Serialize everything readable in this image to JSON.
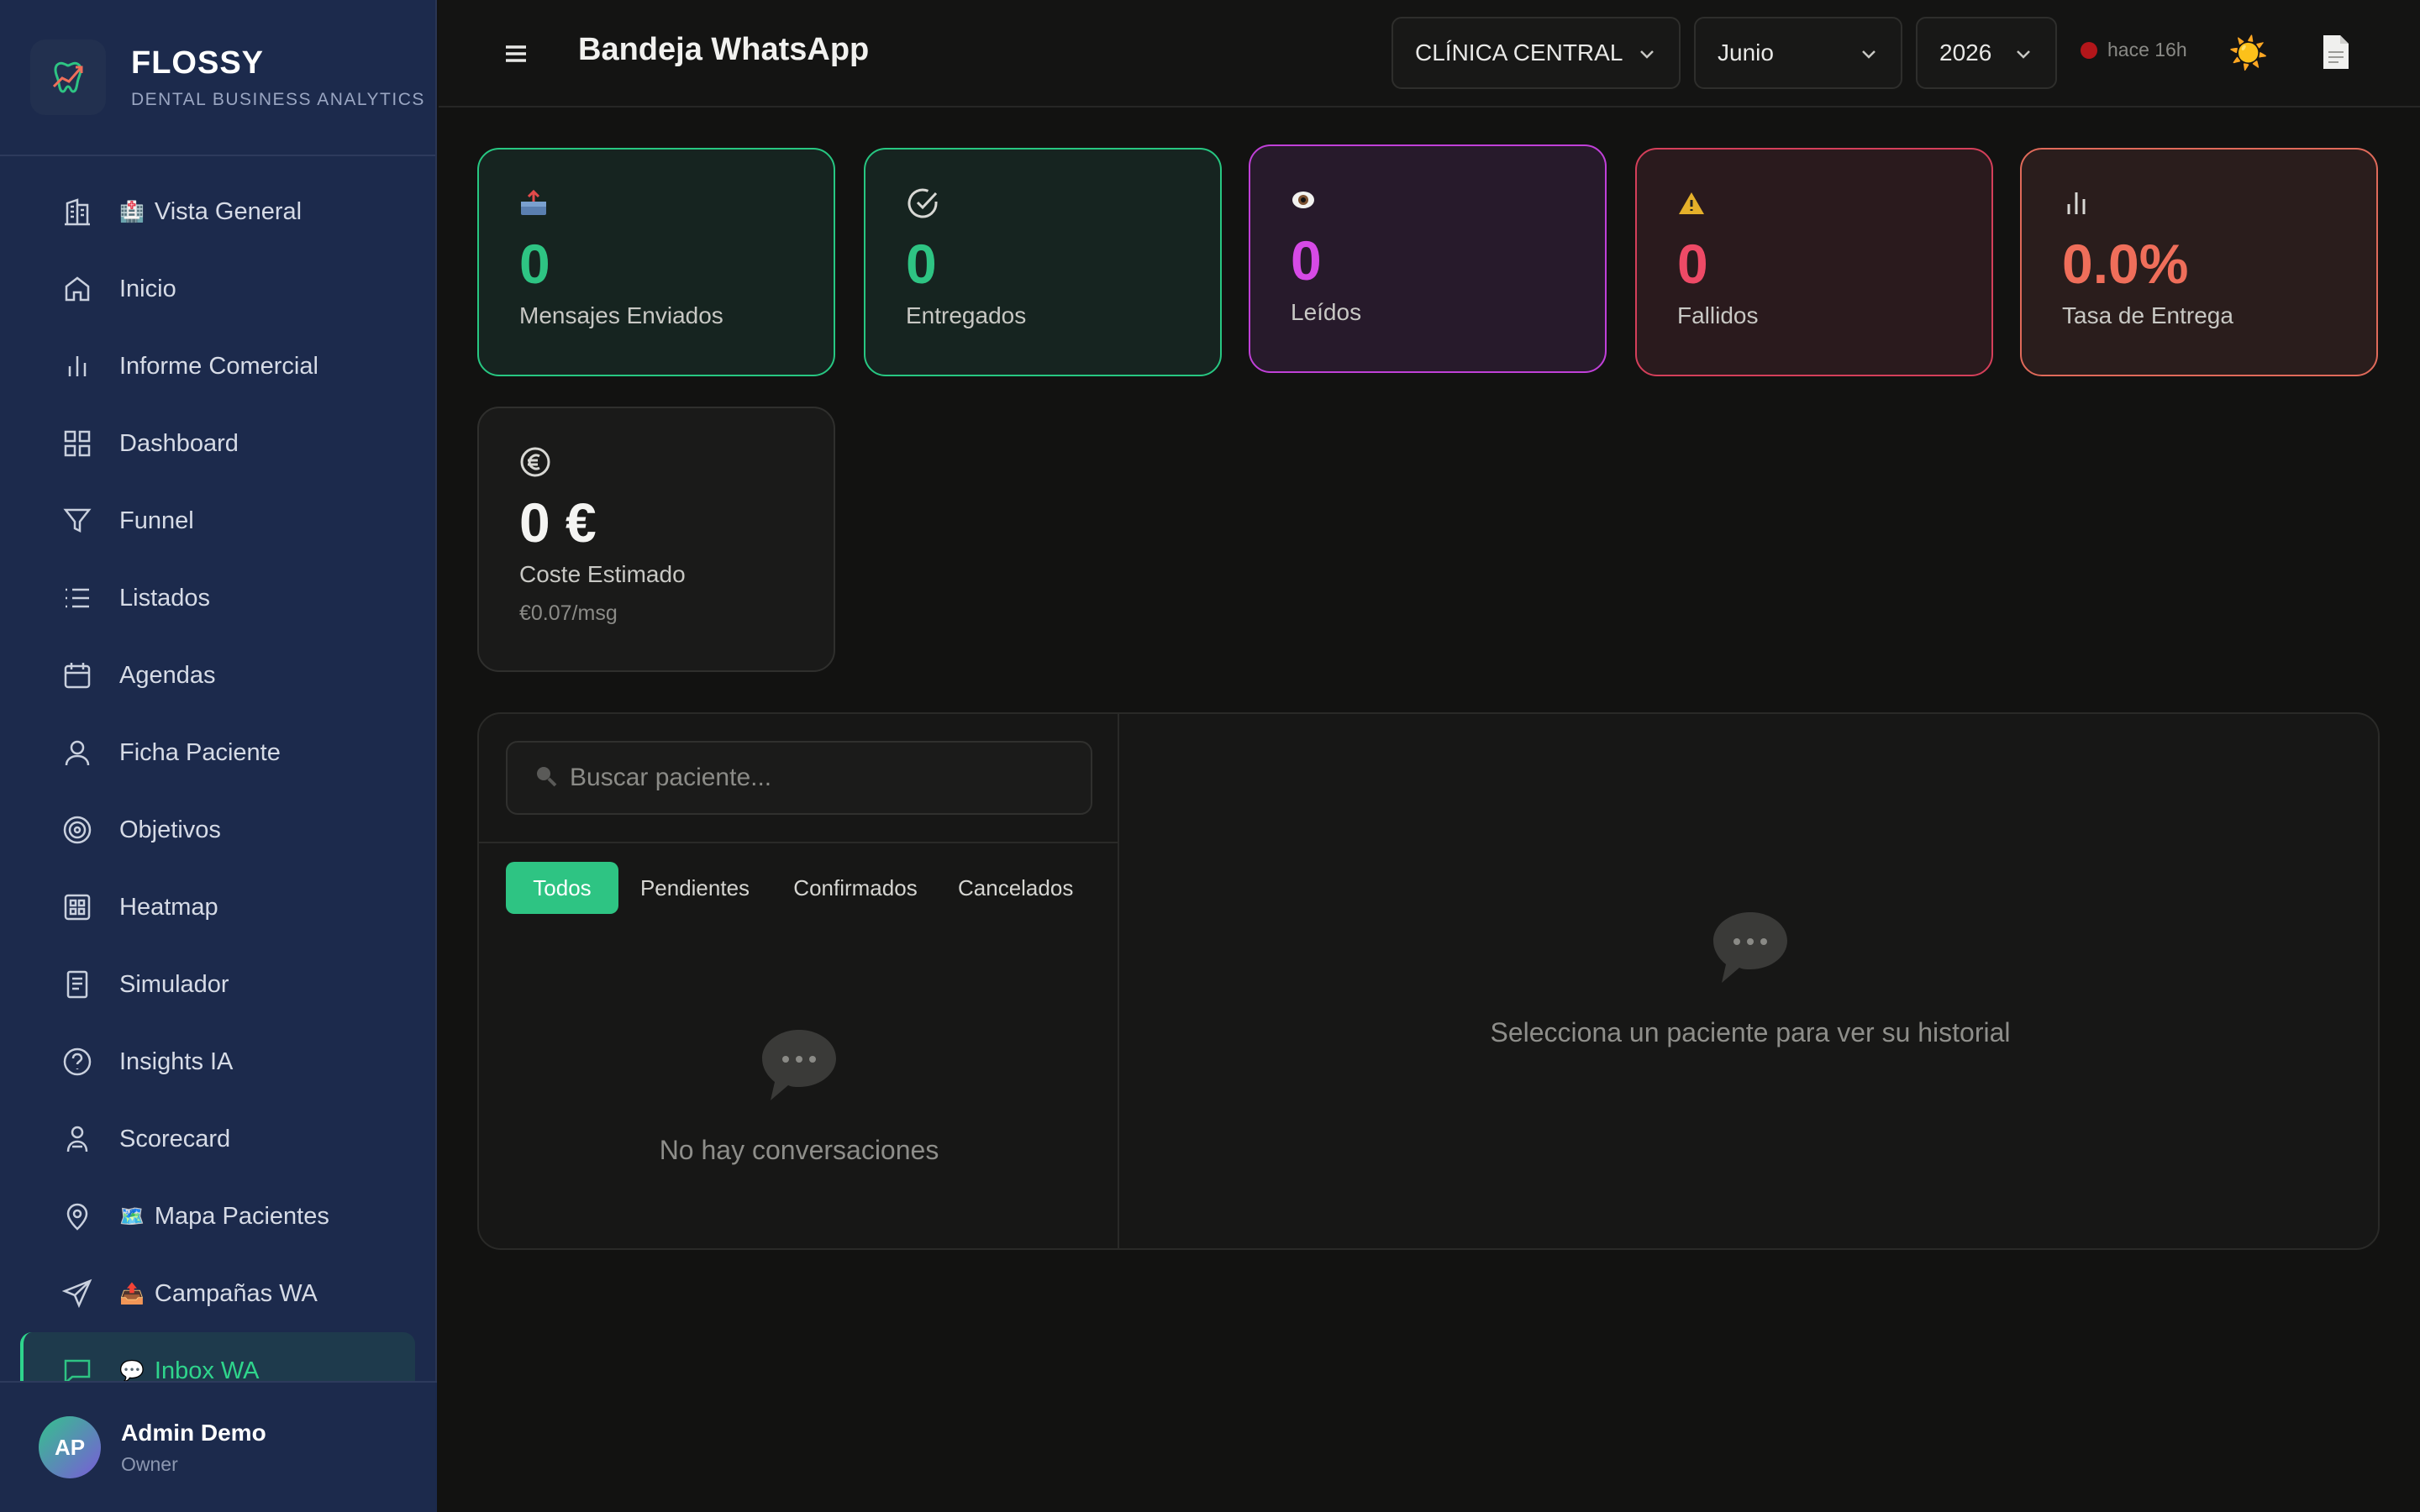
{
  "brand": {
    "name": "FLOSSY",
    "subtitle": "DENTAL BUSINESS ANALYTICS"
  },
  "sidebar": {
    "items": [
      {
        "label": "Vista General",
        "icon": "building-icon",
        "emoji": "🏥"
      },
      {
        "label": "Inicio",
        "icon": "home-icon"
      },
      {
        "label": "Informe Comercial",
        "icon": "bar-chart-icon"
      },
      {
        "label": "Dashboard",
        "icon": "grid-icon"
      },
      {
        "label": "Funnel",
        "icon": "funnel-icon"
      },
      {
        "label": "Listados",
        "icon": "list-icon"
      },
      {
        "label": "Agendas",
        "icon": "calendar-icon"
      },
      {
        "label": "Ficha Paciente",
        "icon": "user-icon"
      },
      {
        "label": "Objetivos",
        "icon": "target-icon"
      },
      {
        "label": "Heatmap",
        "icon": "heatmap-icon"
      },
      {
        "label": "Simulador",
        "icon": "document-icon"
      },
      {
        "label": "Insights IA",
        "icon": "help-circle-icon"
      },
      {
        "label": "Scorecard",
        "icon": "user-check-icon"
      },
      {
        "label": "Mapa Pacientes",
        "icon": "map-pin-icon",
        "emoji": "🗺️"
      },
      {
        "label": "Campañas WA",
        "icon": "send-icon",
        "emoji": "📤"
      },
      {
        "label": "Inbox WA",
        "icon": "message-square-icon",
        "emoji": "💬",
        "active": true
      }
    ]
  },
  "user": {
    "initials": "AP",
    "name": "Admin Demo",
    "role": "Owner"
  },
  "header": {
    "title": "Bandeja WhatsApp",
    "clinic": "CLÍNICA CENTRAL",
    "month": "Junio",
    "year": "2026",
    "sync_status": "hace 16h",
    "sync_color": "#b3161a"
  },
  "stats": {
    "sent": {
      "value": "0",
      "label": "Mensajes Enviados",
      "icon": "outbox-icon"
    },
    "delivered": {
      "value": "0",
      "label": "Entregados",
      "icon": "check-circle-icon"
    },
    "read": {
      "value": "0",
      "label": "Leídos",
      "icon": "eye-icon"
    },
    "failed": {
      "value": "0",
      "label": "Fallidos",
      "icon": "warning-icon"
    },
    "rate": {
      "value": "0.0%",
      "label": "Tasa de Entrega",
      "icon": "bar-chart-icon"
    },
    "cost": {
      "value": "0 €",
      "label": "Coste Estimado",
      "sub": "€0.07/msg",
      "icon": "euro-icon"
    }
  },
  "inbox": {
    "search_placeholder": "Buscar paciente...",
    "filters": [
      "Todos",
      "Pendientes",
      "Confirmados",
      "Cancelados"
    ],
    "active_filter": "Todos",
    "empty_list": "No hay conversaciones",
    "empty_detail": "Selecciona un paciente para ver su historial"
  },
  "colors": {
    "accent": "#2ec483",
    "read": "#d64ae6",
    "failed": "#ee4a66",
    "rate": "#ef6e5a",
    "sidebar": "#1c2a4c"
  }
}
